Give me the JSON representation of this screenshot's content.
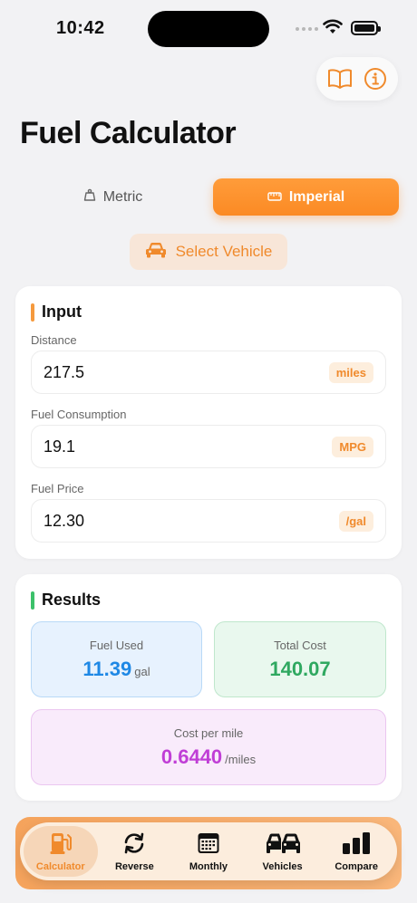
{
  "status_bar": {
    "time": "10:42"
  },
  "header": {
    "title": "Fuel Calculator"
  },
  "units_toggle": {
    "metric_label": "Metric",
    "imperial_label": "Imperial",
    "selected": "Imperial"
  },
  "vehicle": {
    "select_label": "Select Vehicle"
  },
  "input_section": {
    "title": "Input",
    "accent": "#f59a3e",
    "fields": [
      {
        "label": "Distance",
        "value": "217.5",
        "unit": "miles"
      },
      {
        "label": "Fuel Consumption",
        "value": "19.1",
        "unit": "MPG"
      },
      {
        "label": "Fuel Price",
        "value": "12.30",
        "unit": "/gal"
      }
    ]
  },
  "results_section": {
    "title": "Results",
    "accent": "#3cc16a",
    "fuel_used": {
      "label": "Fuel Used",
      "value": "11.39",
      "unit": "gal",
      "color": "#1e88e5"
    },
    "total_cost": {
      "label": "Total Cost",
      "value": "140.07",
      "color": "#2fa860"
    },
    "cost_per_mile": {
      "label": "Cost per mile",
      "value": "0.6440",
      "unit": "/miles",
      "color": "#c03ed6"
    }
  },
  "tabs": [
    {
      "label": "Calculator",
      "icon": "fuel-pump-icon",
      "active": true
    },
    {
      "label": "Reverse",
      "icon": "reverse-arrows-icon",
      "active": false
    },
    {
      "label": "Monthly",
      "icon": "calendar-icon",
      "active": false
    },
    {
      "label": "Vehicles",
      "icon": "cars-icon",
      "active": false
    },
    {
      "label": "Compare",
      "icon": "bar-chart-icon",
      "active": false
    }
  ],
  "colors": {
    "brand": "#f08a2c",
    "background": "#f2f2f4"
  }
}
